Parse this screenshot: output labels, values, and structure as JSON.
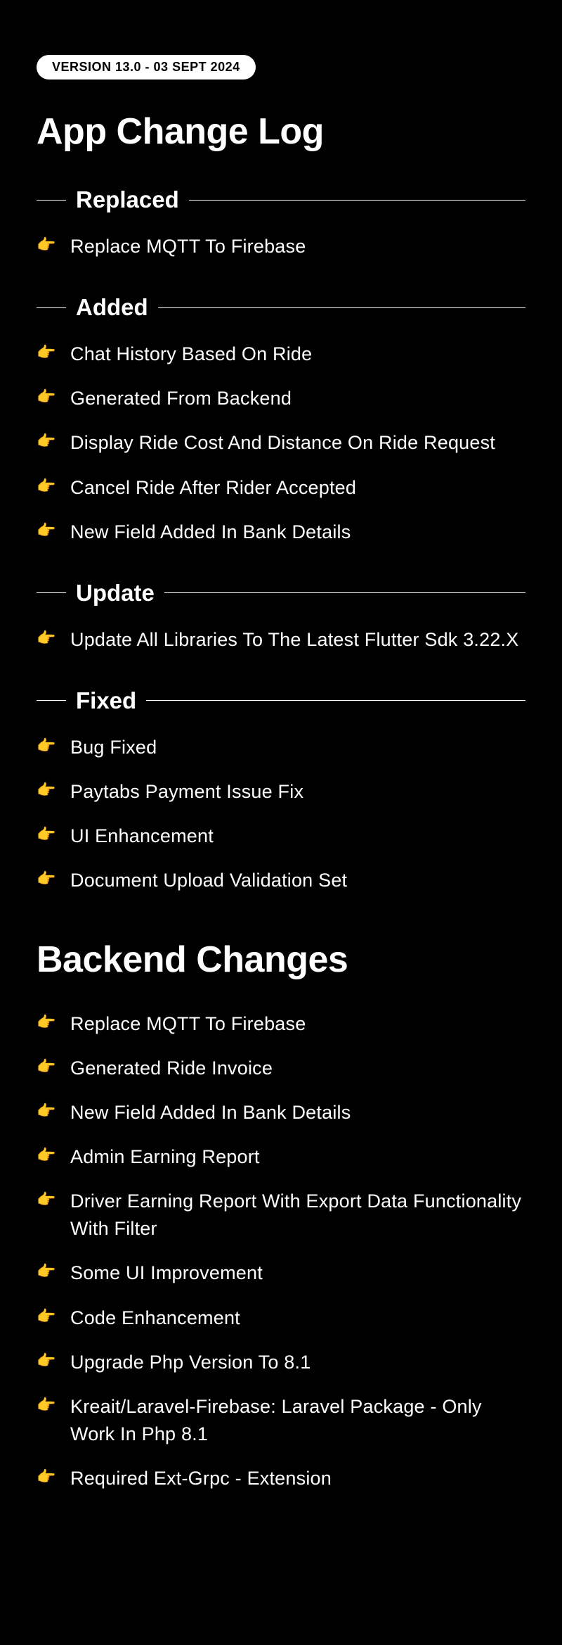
{
  "version_badge": "VERSION 13.0 - 03 SEPT 2024",
  "page_title": "App Change Log",
  "sections": {
    "replaced": {
      "title": "Replaced",
      "items": [
        "Replace MQTT To Firebase"
      ]
    },
    "added": {
      "title": "Added",
      "items": [
        "Chat History Based On Ride",
        "Generated From Backend",
        "Display Ride Cost And Distance On Ride Request",
        "Cancel Ride After Rider Accepted",
        "New Field Added In Bank Details"
      ]
    },
    "update": {
      "title": "Update",
      "items": [
        "Update All Libraries To The Latest Flutter Sdk 3.22.X"
      ]
    },
    "fixed": {
      "title": "Fixed",
      "items": [
        "Bug Fixed",
        "Paytabs Payment Issue Fix",
        "UI Enhancement",
        "Document Upload Validation Set"
      ]
    }
  },
  "backend": {
    "title": "Backend Changes",
    "items": [
      "Replace MQTT To Firebase",
      "Generated Ride Invoice",
      "New Field Added In Bank Details",
      "Admin Earning Report",
      "Driver Earning Report With Export Data Functionality With Filter",
      "Some UI Improvement",
      "Code Enhancement",
      "Upgrade Php Version To 8.1",
      "Kreait/Laravel-Firebase: Laravel Package - Only Work In Php 8.1",
      "Required Ext-Grpc - Extension"
    ]
  },
  "bullet_emoji": "👉"
}
